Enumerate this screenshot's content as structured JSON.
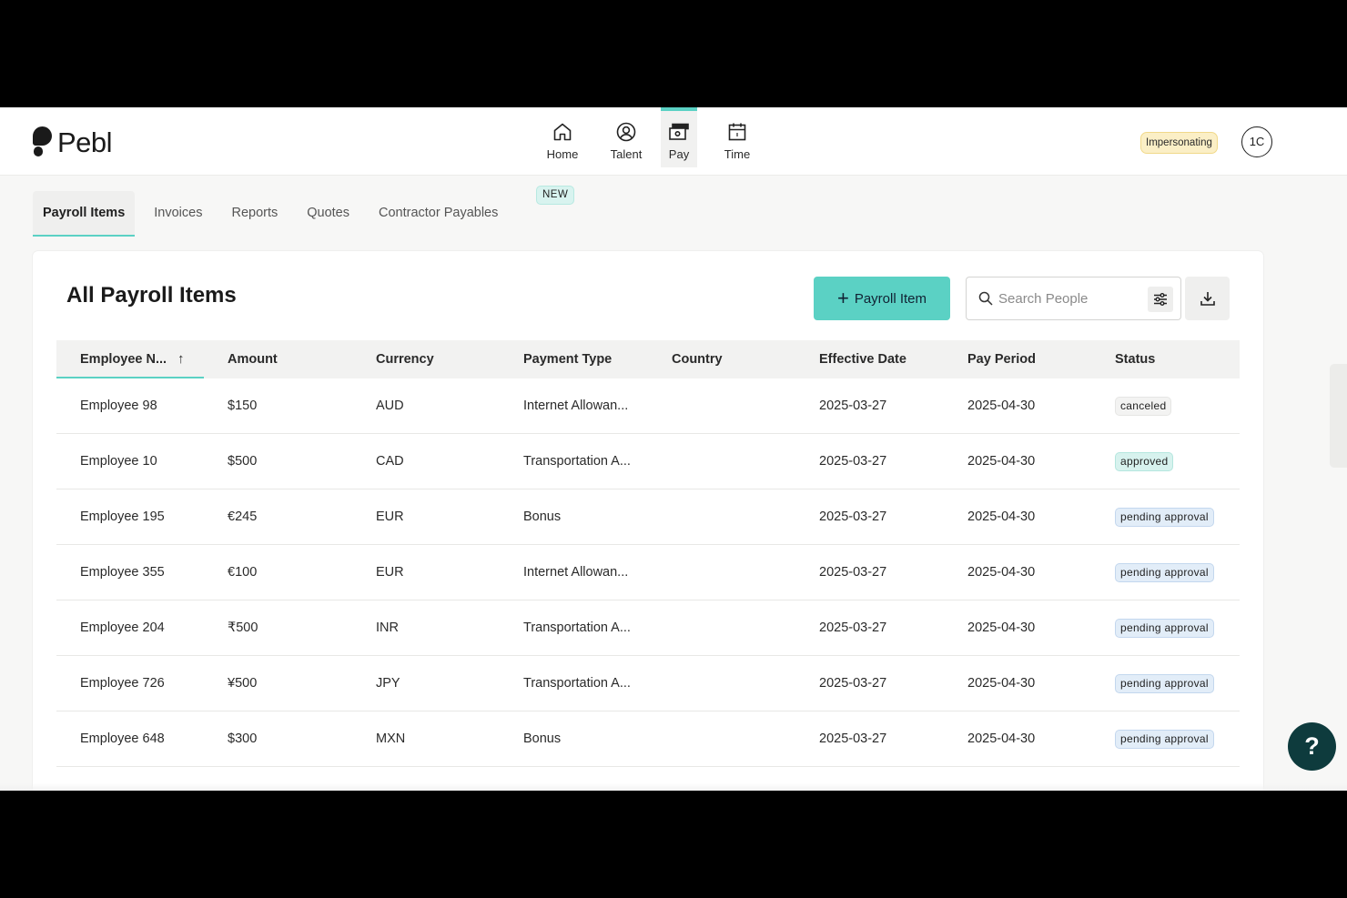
{
  "brand": {
    "name": "Pebl"
  },
  "nav": {
    "items": [
      {
        "label": "Home",
        "icon": "home-icon"
      },
      {
        "label": "Talent",
        "icon": "talent-icon"
      },
      {
        "label": "Pay",
        "icon": "pay-icon",
        "active": true
      },
      {
        "label": "Time",
        "icon": "calendar-icon"
      }
    ]
  },
  "header": {
    "impersonating_label": "Impersonating",
    "avatar_initials": "1C"
  },
  "subtabs": {
    "items": [
      {
        "label": "Payroll Items",
        "active": true
      },
      {
        "label": "Invoices"
      },
      {
        "label": "Reports"
      },
      {
        "label": "Quotes"
      },
      {
        "label": "Contractor Payables"
      }
    ],
    "new_badge": "NEW"
  },
  "main": {
    "title": "All Payroll Items",
    "add_button_label": "Payroll Item",
    "search_placeholder": "Search People"
  },
  "table": {
    "columns": [
      "Employee N...",
      "Amount",
      "Currency",
      "Payment Type",
      "Country",
      "Effective Date",
      "Pay Period",
      "Status"
    ],
    "sort_indicator": "↑",
    "rows": [
      {
        "employee": "Employee 98",
        "amount": "$150",
        "currency": "AUD",
        "payment_type": "Internet Allowan...",
        "country": "",
        "effective_date": "2025-03-27",
        "pay_period": "2025-04-30",
        "status": "canceled",
        "status_kind": "canceled"
      },
      {
        "employee": "Employee 10",
        "amount": "$500",
        "currency": "CAD",
        "payment_type": "Transportation A...",
        "country": "",
        "effective_date": "2025-03-27",
        "pay_period": "2025-04-30",
        "status": "approved",
        "status_kind": "approved"
      },
      {
        "employee": "Employee 195",
        "amount": "€245",
        "currency": "EUR",
        "payment_type": "Bonus",
        "country": "",
        "effective_date": "2025-03-27",
        "pay_period": "2025-04-30",
        "status": "pending approval",
        "status_kind": "pending"
      },
      {
        "employee": "Employee 355",
        "amount": "€100",
        "currency": "EUR",
        "payment_type": "Internet Allowan...",
        "country": "",
        "effective_date": "2025-03-27",
        "pay_period": "2025-04-30",
        "status": "pending approval",
        "status_kind": "pending"
      },
      {
        "employee": "Employee 204",
        "amount": "₹500",
        "currency": "INR",
        "payment_type": "Transportation A...",
        "country": "",
        "effective_date": "2025-03-27",
        "pay_period": "2025-04-30",
        "status": "pending approval",
        "status_kind": "pending"
      },
      {
        "employee": "Employee 726",
        "amount": "¥500",
        "currency": "JPY",
        "payment_type": "Transportation A...",
        "country": "",
        "effective_date": "2025-03-27",
        "pay_period": "2025-04-30",
        "status": "pending approval",
        "status_kind": "pending"
      },
      {
        "employee": "Employee 648",
        "amount": "$300",
        "currency": "MXN",
        "payment_type": "Bonus",
        "country": "",
        "effective_date": "2025-03-27",
        "pay_period": "2025-04-30",
        "status": "pending approval",
        "status_kind": "pending"
      }
    ]
  },
  "help": {
    "label": "?"
  },
  "colors": {
    "accent": "#5bd1c4",
    "help_bg": "#0e3b3d",
    "impersonating_bg": "#fbefc6"
  }
}
